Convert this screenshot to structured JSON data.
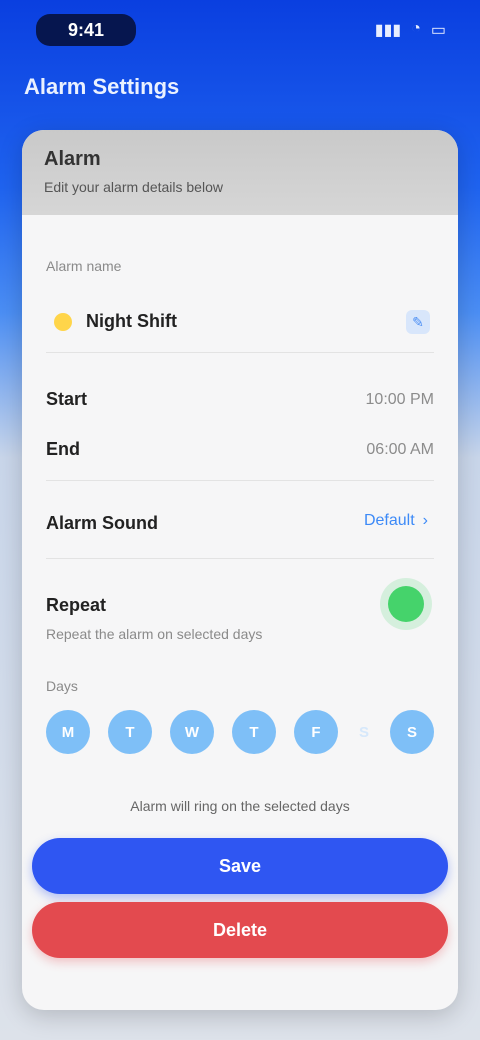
{
  "status_bar": {
    "time": "9:41",
    "icons": [
      "signal-icon",
      "wifi-icon",
      "battery-icon"
    ],
    "icon_glyphs": [
      "▮▮▮",
      "◔",
      "▭"
    ]
  },
  "page_title": "Alarm Settings",
  "sheet": {
    "heading": "Alarm",
    "subtitle": "Edit your alarm details below",
    "section_label": "Alarm name",
    "alarm_name": "Night Shift",
    "rows": [
      {
        "title": "Start",
        "value": "10:00 PM"
      },
      {
        "title": "End",
        "value": "06:00 AM"
      }
    ],
    "sound": {
      "title": "Alarm Sound",
      "value": "Default"
    },
    "repeat": {
      "title": "Repeat",
      "subtitle": "Repeat the alarm on selected days"
    },
    "days_label": "Days",
    "days": [
      {
        "label": "M",
        "on": true
      },
      {
        "label": "T",
        "on": true
      },
      {
        "label": "W",
        "on": true
      },
      {
        "label": "T",
        "on": true
      },
      {
        "label": "F",
        "on": true
      },
      {
        "label": "S",
        "on": false
      },
      {
        "label": "S",
        "on": true
      }
    ],
    "footnote": "Alarm will ring on the selected days",
    "save_label": "Save",
    "delete_label": "Delete"
  },
  "colors": {
    "primary": "#2f56f2",
    "danger": "#e34a4f",
    "toggle_on": "#45d36b",
    "accent_blue": "#4b8ef4"
  }
}
